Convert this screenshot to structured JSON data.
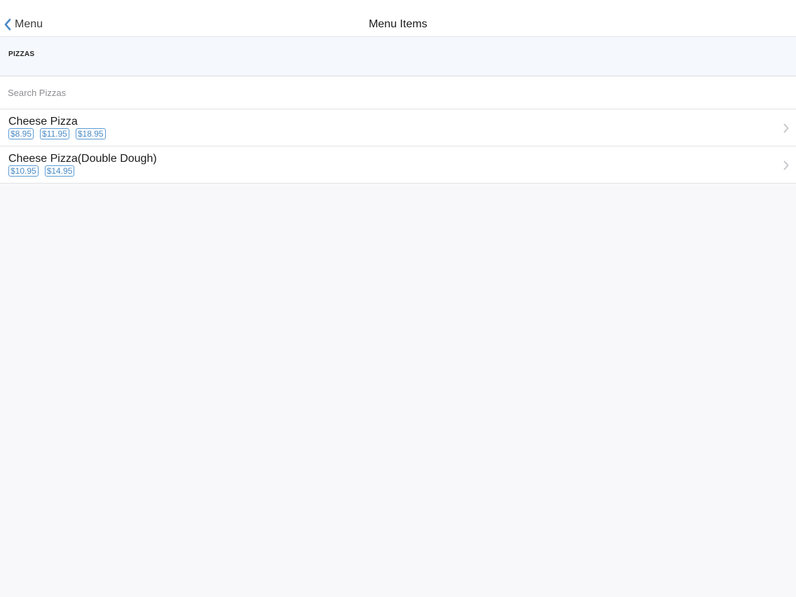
{
  "navbar": {
    "back_label": "Menu",
    "title": "Menu Items"
  },
  "section": {
    "title": "PIZZAS"
  },
  "search": {
    "placeholder": "Search Pizzas",
    "value": ""
  },
  "items": [
    {
      "name": "Cheese Pizza",
      "prices": [
        "$8.95",
        "$11.95",
        "$18.95"
      ]
    },
    {
      "name": "Cheese Pizza(Double Dough)",
      "prices": [
        "$10.95",
        "$14.95"
      ]
    }
  ],
  "colors": {
    "accent": "#4a8bc6",
    "background": "#f8f7f9",
    "section_background": "#f5f8fc"
  },
  "icons": {
    "back": "chevron-left-icon",
    "disclosure": "chevron-right-icon"
  }
}
